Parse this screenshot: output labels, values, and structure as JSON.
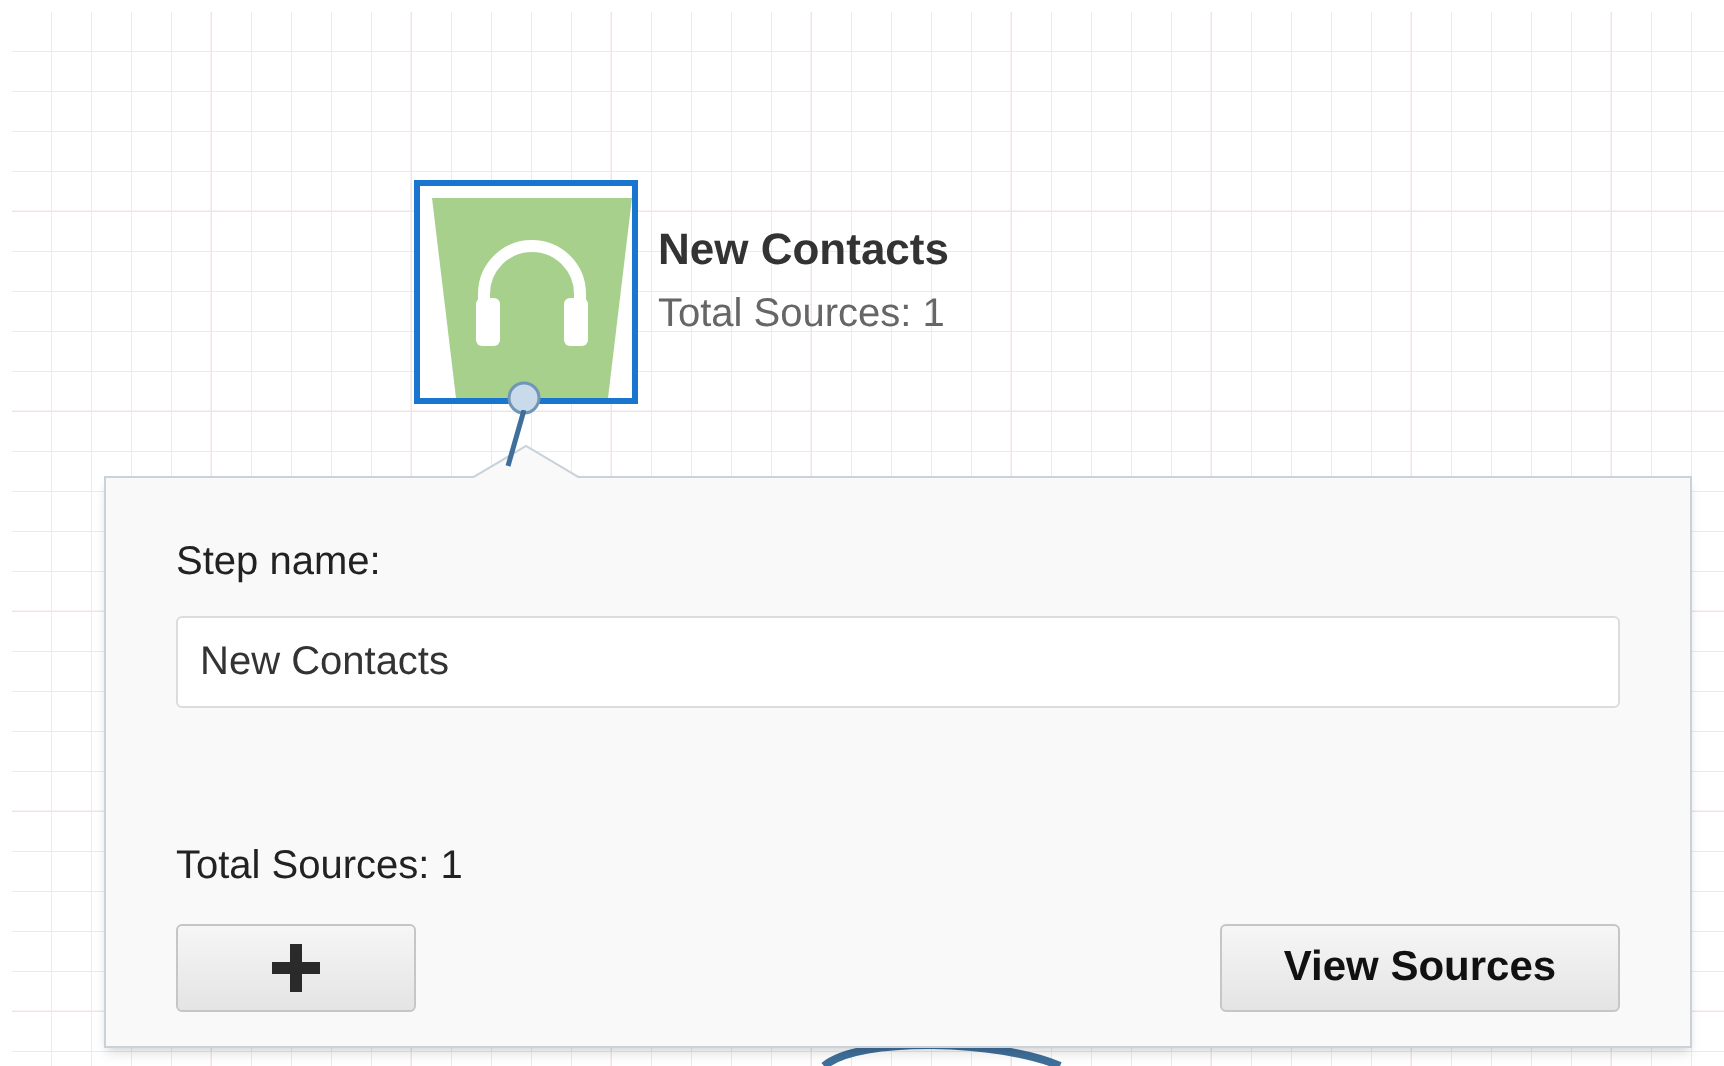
{
  "node": {
    "title": "New Contacts",
    "subtitle": "Total Sources: 1",
    "selected": true
  },
  "popover": {
    "field_label": "Step name:",
    "step_name": "New Contacts",
    "total": "Total Sources: 1",
    "buttons": [
      {
        "kind": "add"
      },
      {
        "kind": "text",
        "label": "View Sources"
      }
    ]
  }
}
